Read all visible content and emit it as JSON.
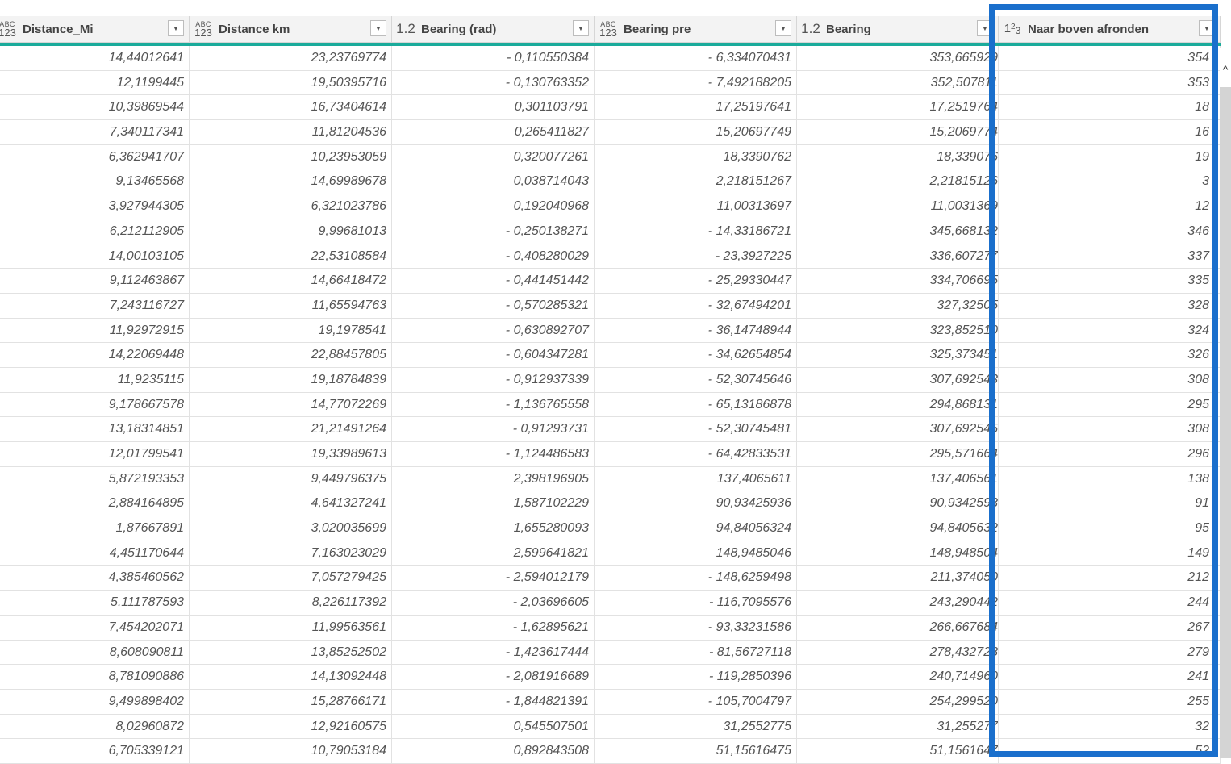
{
  "columns": [
    {
      "type_icon": "abc-123-icon",
      "type_top": "ABC",
      "type_bottom": "123",
      "label": "Distance_Mi"
    },
    {
      "type_icon": "abc-123-icon",
      "type_top": "ABC",
      "type_bottom": "123",
      "label": "Distance km"
    },
    {
      "type_icon": "decimal-icon",
      "type_text": "1.2",
      "label": "Bearing (rad)"
    },
    {
      "type_icon": "abc-123-icon",
      "type_top": "ABC",
      "type_bottom": "123",
      "label": "Bearing pre"
    },
    {
      "type_icon": "decimal-icon",
      "type_text": "1.2",
      "label": "Bearing"
    },
    {
      "type_icon": "whole-number-icon",
      "type_base": "1",
      "type_sup": "2",
      "type_sub": "3",
      "label": "Naar boven afronden"
    }
  ],
  "dropdown_glyph": "▼",
  "scroll_up_glyph": "^",
  "highlight_color": "#1a6fcc",
  "header_accent_color": "#1aab9b",
  "rows": [
    [
      "14,44012641",
      "23,23769774",
      "- 0,110550384",
      "- 6,334070431",
      "353,665929",
      "354"
    ],
    [
      "12,1199445",
      "19,50395716",
      "- 0,130763352",
      "- 7,492188205",
      "352,507811",
      "353"
    ],
    [
      "10,39869544",
      "16,73404614",
      "0,301103791",
      "17,25197641",
      "17,2519764",
      "18"
    ],
    [
      "7,340117341",
      "11,81204536",
      "0,265411827",
      "15,20697749",
      "15,2069774",
      "16"
    ],
    [
      "6,362941707",
      "10,23953059",
      "0,320077261",
      "18,3390762",
      "18,339076",
      "19"
    ],
    [
      "9,13465568",
      "14,69989678",
      "0,038714043",
      "2,218151267",
      "2,21815126",
      "3"
    ],
    [
      "3,927944305",
      "6,321023786",
      "0,192040968",
      "11,00313697",
      "11,0031369",
      "12"
    ],
    [
      "6,212112905",
      "9,99681013",
      "- 0,250138271",
      "- 14,33186721",
      "345,668132",
      "346"
    ],
    [
      "14,00103105",
      "22,53108584",
      "- 0,408280029",
      "- 23,3927225",
      "336,607277",
      "337"
    ],
    [
      "9,112463867",
      "14,66418472",
      "- 0,441451442",
      "- 25,29330447",
      "334,706695",
      "335"
    ],
    [
      "7,243116727",
      "11,65594763",
      "- 0,570285321",
      "- 32,67494201",
      "327,32505",
      "328"
    ],
    [
      "11,92972915",
      "19,1978541",
      "- 0,630892707",
      "- 36,14748944",
      "323,852510",
      "324"
    ],
    [
      "14,22069448",
      "22,88457805",
      "- 0,604347281",
      "- 34,62654854",
      "325,373451",
      "326"
    ],
    [
      "11,9235115",
      "19,18784839",
      "- 0,912937339",
      "- 52,30745646",
      "307,692543",
      "308"
    ],
    [
      "9,178667578",
      "14,77072269",
      "- 1,136765558",
      "- 65,13186878",
      "294,868131",
      "295"
    ],
    [
      "13,18314851",
      "21,21491264",
      "- 0,91293731",
      "- 52,30745481",
      "307,692545",
      "308"
    ],
    [
      "12,01799541",
      "19,33989613",
      "- 1,124486583",
      "- 64,42833531",
      "295,571664",
      "296"
    ],
    [
      "5,872193353",
      "9,449796375",
      "2,398196905",
      "137,4065611",
      "137,406561",
      "138"
    ],
    [
      "2,884164895",
      "4,641327241",
      "1,587102229",
      "90,93425936",
      "90,9342593",
      "91"
    ],
    [
      "1,87667891",
      "3,020035699",
      "1,655280093",
      "94,84056324",
      "94,8405632",
      "95"
    ],
    [
      "4,451170644",
      "7,163023029",
      "2,599641821",
      "148,9485046",
      "148,948504",
      "149"
    ],
    [
      "4,385460562",
      "7,057279425",
      "- 2,594012179",
      "- 148,6259498",
      "211,374050",
      "212"
    ],
    [
      "5,111787593",
      "8,226117392",
      "- 2,03696605",
      "- 116,7095576",
      "243,290442",
      "244"
    ],
    [
      "7,454202071",
      "11,99563561",
      "- 1,62895621",
      "- 93,33231586",
      "266,667684",
      "267"
    ],
    [
      "8,608090811",
      "13,85252502",
      "- 1,423617444",
      "- 81,56727118",
      "278,432728",
      "279"
    ],
    [
      "8,781090886",
      "14,13092448",
      "- 2,081916689",
      "- 119,2850396",
      "240,714960",
      "241"
    ],
    [
      "9,499898402",
      "15,28766171",
      "- 1,844821391",
      "- 105,7004797",
      "254,299520",
      "255"
    ],
    [
      "8,02960872",
      "12,92160575",
      "0,545507501",
      "31,2552775",
      "31,255277",
      "32"
    ],
    [
      "6,705339121",
      "10,79053184",
      "0,892843508",
      "51,15616475",
      "51,1561647",
      "52"
    ]
  ]
}
